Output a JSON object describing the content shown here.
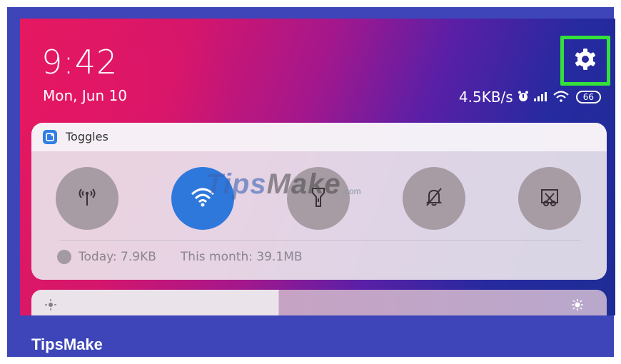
{
  "status_bar": {
    "time": "9:42",
    "date": "Mon, Jun 10",
    "network_speed": "4.5KB/s",
    "battery_level": "66",
    "icons": [
      "alarm-icon",
      "signal-icon",
      "wifi-icon",
      "battery-icon"
    ]
  },
  "settings": {
    "icon": "gear-icon",
    "highlight_color": "#34e03a"
  },
  "panel": {
    "title": "Toggles",
    "toggles": [
      {
        "icon": "hotspot-icon",
        "active": false
      },
      {
        "icon": "wifi-icon",
        "active": true
      },
      {
        "icon": "flashlight-icon",
        "active": false
      },
      {
        "icon": "silent-bell-icon",
        "active": false
      },
      {
        "icon": "screenshot-icon",
        "active": false
      }
    ],
    "usage": {
      "today": "Today: 7.9KB",
      "month": "This month: 39.1MB"
    }
  },
  "watermark": {
    "part1": "Tips",
    "part2": "Make",
    "suffix": ".com"
  },
  "footer": {
    "brand": "TipsMake"
  },
  "colors": {
    "accent_blue": "#2e78dc",
    "frame_blue": "#3d45b8",
    "highlight_green": "#34e03a"
  }
}
